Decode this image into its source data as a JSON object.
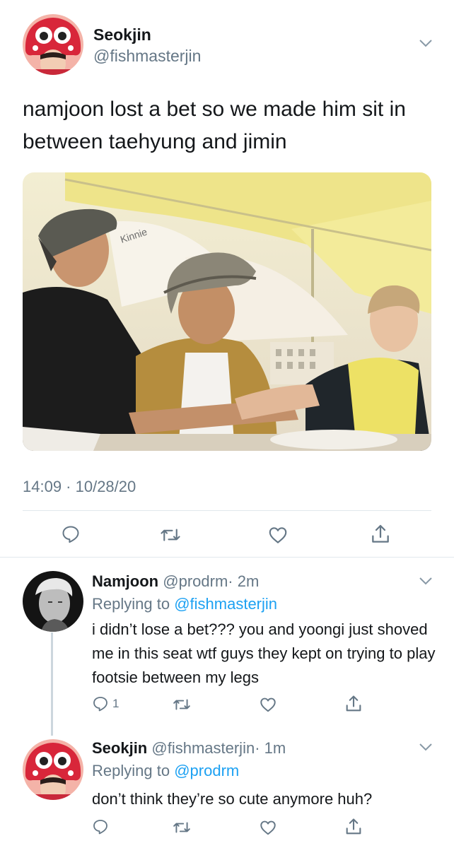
{
  "main_tweet": {
    "display_name": "Seokjin",
    "handle": "@fishmasterjin",
    "text": "namjoon lost a bet so we made him sit in between taehyung and jimin",
    "timestamp": "14:09 · 10/28/20",
    "avatar_icon": "avatar-red-octopus-hat",
    "media_icon": "photo-three-men-under-umbrellas"
  },
  "replies": [
    {
      "display_name": "Namjoon",
      "handle": "@prodrm",
      "age": "· 2m",
      "replying_label": "Replying to",
      "replying_to": "@fishmasterjin",
      "text": "i didn’t lose a bet??? you and yoongi just shoved me in this seat wtf guys they kept on trying to play footsie between my legs",
      "reply_count": "1",
      "avatar_icon": "avatar-grayscale-portrait"
    },
    {
      "display_name": "Seokjin",
      "handle": "@fishmasterjin",
      "age": "· 1m",
      "replying_label": "Replying to",
      "replying_to": "@prodrm",
      "text": "don’t think they’re so cute anymore huh?",
      "reply_count": "",
      "avatar_icon": "avatar-red-octopus-hat"
    }
  ],
  "colors": {
    "text": "#14171a",
    "secondary": "#657786",
    "link": "#1da1f2",
    "divider": "#e1e8ed"
  }
}
